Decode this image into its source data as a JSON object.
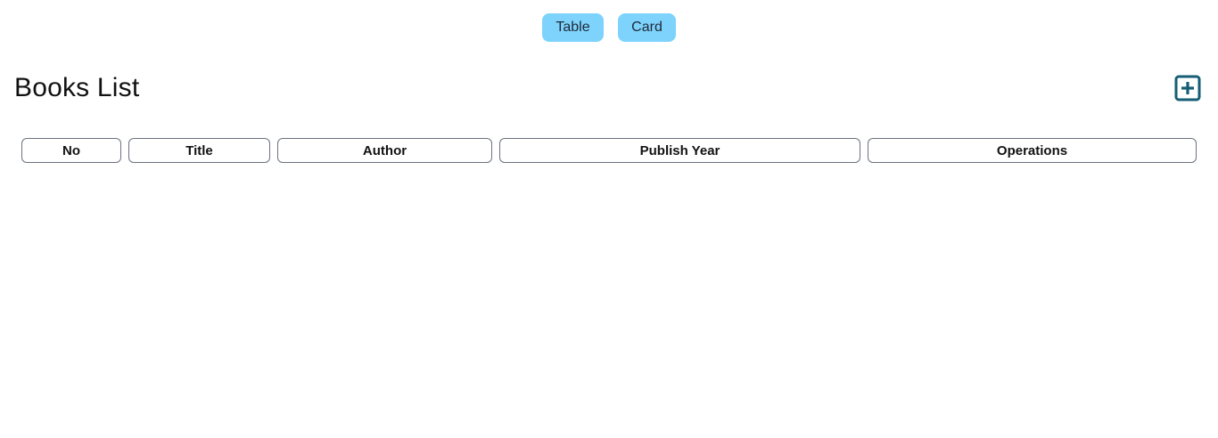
{
  "view_toggle": {
    "table_label": "Table",
    "card_label": "Card",
    "button_color": "#7dd3fc"
  },
  "header": {
    "title": "Books List",
    "add_icon": "plus-square-icon",
    "add_icon_color": "#155e75"
  },
  "table": {
    "columns": [
      "No",
      "Title",
      "Author",
      "Publish Year",
      "Operations"
    ],
    "rows": []
  }
}
